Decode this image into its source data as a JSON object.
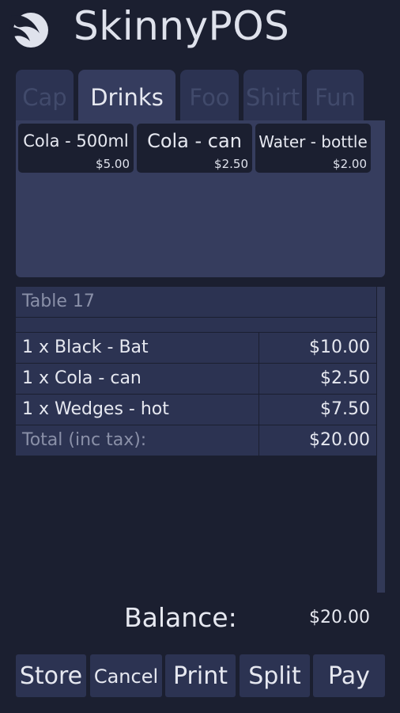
{
  "header": {
    "title": "SkinnyPOS"
  },
  "tabs": [
    {
      "label": "Cap",
      "active": false
    },
    {
      "label": "Drinks",
      "active": true
    },
    {
      "label": "Foo",
      "active": false
    },
    {
      "label": "Shirt",
      "active": false
    },
    {
      "label": "Fun",
      "active": false
    }
  ],
  "products": [
    {
      "name": "Cola - 500ml",
      "price": "$5.00"
    },
    {
      "name": "Cola - can",
      "price": "$2.50"
    },
    {
      "name": "Water - bottle",
      "price": "$2.00"
    }
  ],
  "order": {
    "table_label": "Table 17",
    "lines": [
      {
        "desc": "1 x Black - Bat",
        "price": "$10.00"
      },
      {
        "desc": "1 x Cola - can",
        "price": "$2.50"
      },
      {
        "desc": "1 x Wedges - hot",
        "price": "$7.50"
      }
    ],
    "total_label": "Total (inc tax):",
    "total_value": "$20.00"
  },
  "balance": {
    "label": "Balance:",
    "value": "$20.00"
  },
  "actions": {
    "store": "Store",
    "cancel": "Cancel",
    "print": "Print",
    "split": "Split",
    "pay": "Pay"
  },
  "colors": {
    "background": "#1b1f30",
    "panel": "#363d5e",
    "row": "#2c3352",
    "text": "#e6e8f0"
  }
}
